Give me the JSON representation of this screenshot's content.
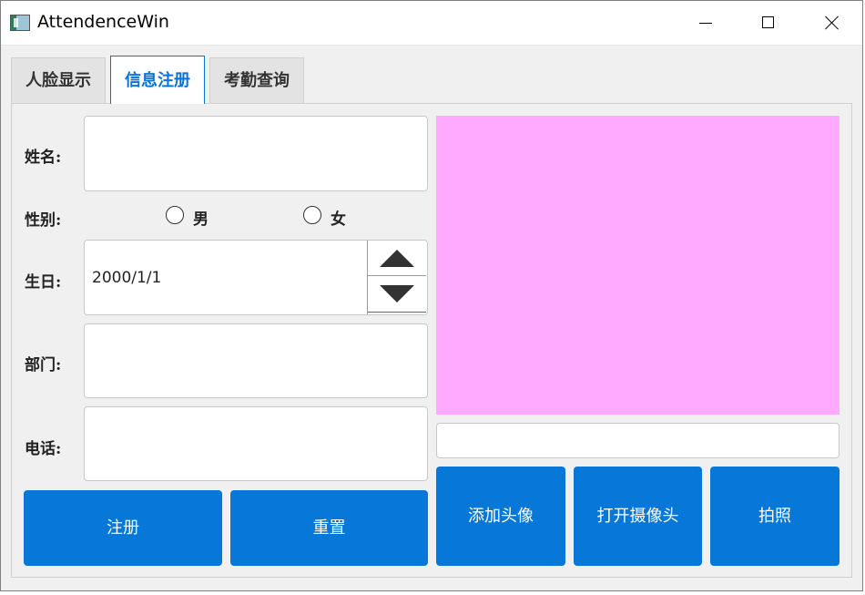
{
  "window": {
    "title": "AttendenceWin"
  },
  "tabs": [
    {
      "label": "人脸显示"
    },
    {
      "label": "信息注册"
    },
    {
      "label": "考勤查询"
    }
  ],
  "form": {
    "name_label": "姓名:",
    "name_value": "",
    "gender_label": "性别:",
    "gender_options": [
      "男",
      "女"
    ],
    "birthday_label": "生日:",
    "birthday_value": "2000/1/1",
    "department_label": "部门:",
    "department_value": "",
    "phone_label": "电话:",
    "phone_value": ""
  },
  "buttons": {
    "register": "注册",
    "reset": "重置",
    "add_avatar": "添加头像",
    "open_camera": "打开摄像头",
    "take_photo": "拍照"
  },
  "preview": {
    "path_value": "",
    "background_color": "#ffaaff"
  },
  "colors": {
    "accent": "#0778d8",
    "active_tab_text": "#0a74d6"
  },
  "icons": {
    "app": "app-window-icon",
    "minimize": "minimize-icon",
    "maximize": "maximize-icon",
    "close": "close-icon",
    "spin_up": "triangle-up-icon",
    "spin_down": "triangle-down-icon"
  }
}
